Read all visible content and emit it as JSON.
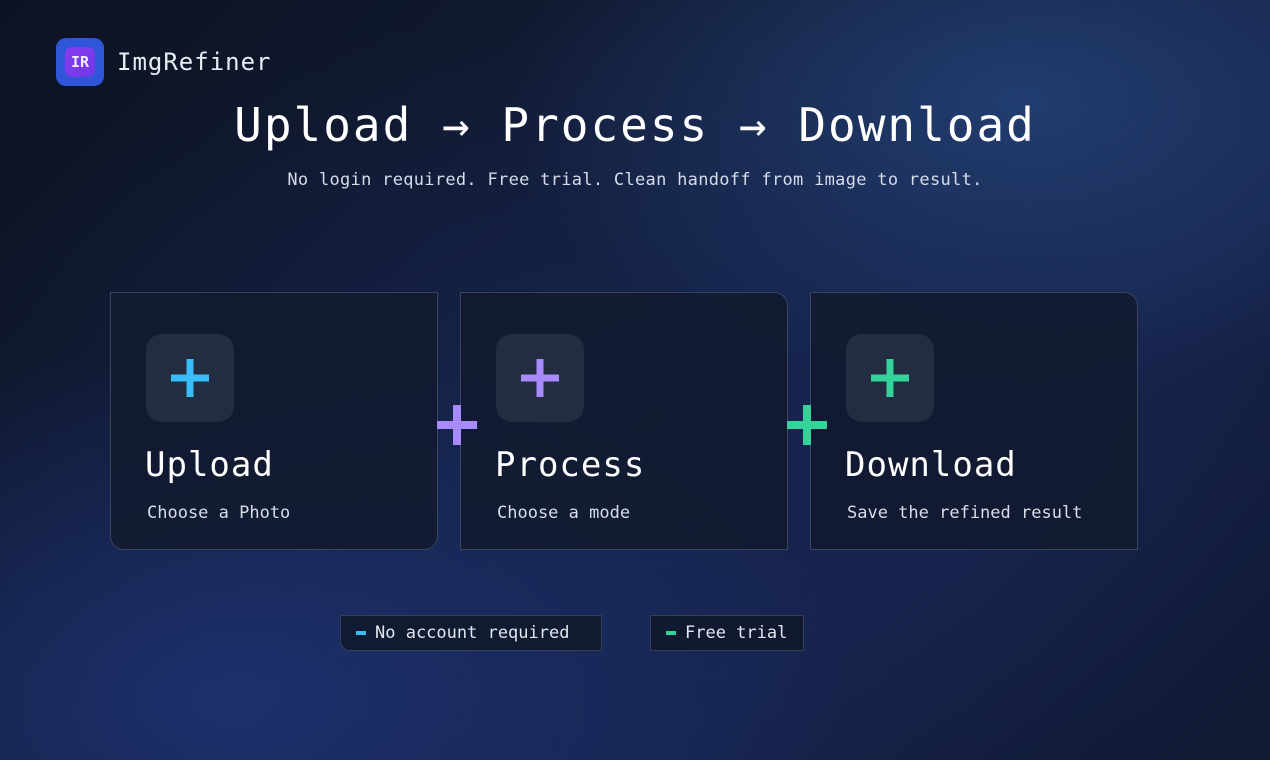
{
  "brand": {
    "logo_text": "IR",
    "name": "ImgRefiner"
  },
  "hero": {
    "title": "Upload → Process → Download",
    "subtitle": "No login required. Free trial. Clean handoff from image to result."
  },
  "steps": [
    {
      "title": "Upload",
      "description": "Choose a Photo",
      "icon": "plus-icon",
      "color": "#38bdf8"
    },
    {
      "title": "Process",
      "description": "Choose a mode",
      "icon": "plus-icon",
      "color": "#a78bfa"
    },
    {
      "title": "Download",
      "description": "Save the refined result",
      "icon": "plus-icon",
      "color": "#34d399"
    }
  ],
  "connectors": [
    {
      "icon": "plus-icon",
      "color": "#a78bfa"
    },
    {
      "icon": "plus-icon",
      "color": "#34d399"
    }
  ],
  "badges": [
    {
      "label": "No account required",
      "color": "#38bdf8"
    },
    {
      "label": "Free trial",
      "color": "#34d399"
    }
  ]
}
